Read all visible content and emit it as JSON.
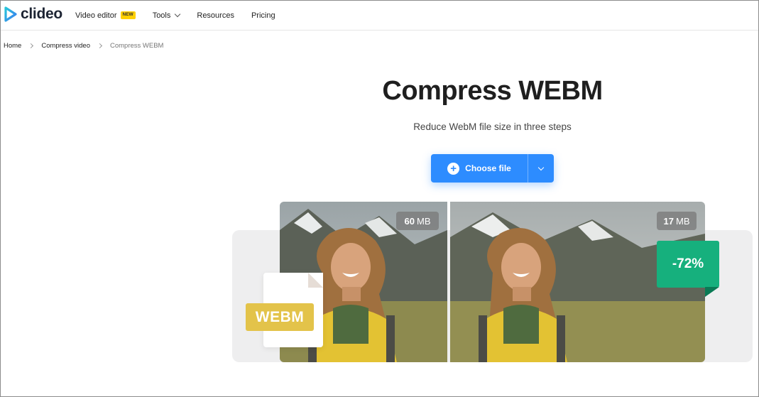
{
  "header": {
    "logo_text": "clideo",
    "nav": [
      {
        "label": "Video editor",
        "badge": "NEW"
      },
      {
        "label": "Tools",
        "has_dropdown": true
      },
      {
        "label": "Resources"
      },
      {
        "label": "Pricing"
      }
    ]
  },
  "breadcrumb": [
    "Home",
    "Compress video",
    "Compress WEBM"
  ],
  "hero": {
    "title": "Compress WEBM",
    "subtitle": "Reduce WebM file size in three steps",
    "choose_file_label": "Choose file"
  },
  "illustration": {
    "before_size_value": "60",
    "before_size_unit": "MB",
    "after_size_value": "17",
    "after_size_unit": "MB",
    "reduction": "-72%",
    "file_type_label": "WEBM"
  },
  "colors": {
    "accent": "#2d8cff",
    "badge_new": "#ffd000",
    "reduction_green": "#16b07d",
    "webm_label": "#e3c34a"
  },
  "icons": [
    "clideo-logo-icon",
    "chevron-down-icon",
    "chevron-right-icon",
    "plus-icon",
    "file-icon"
  ]
}
